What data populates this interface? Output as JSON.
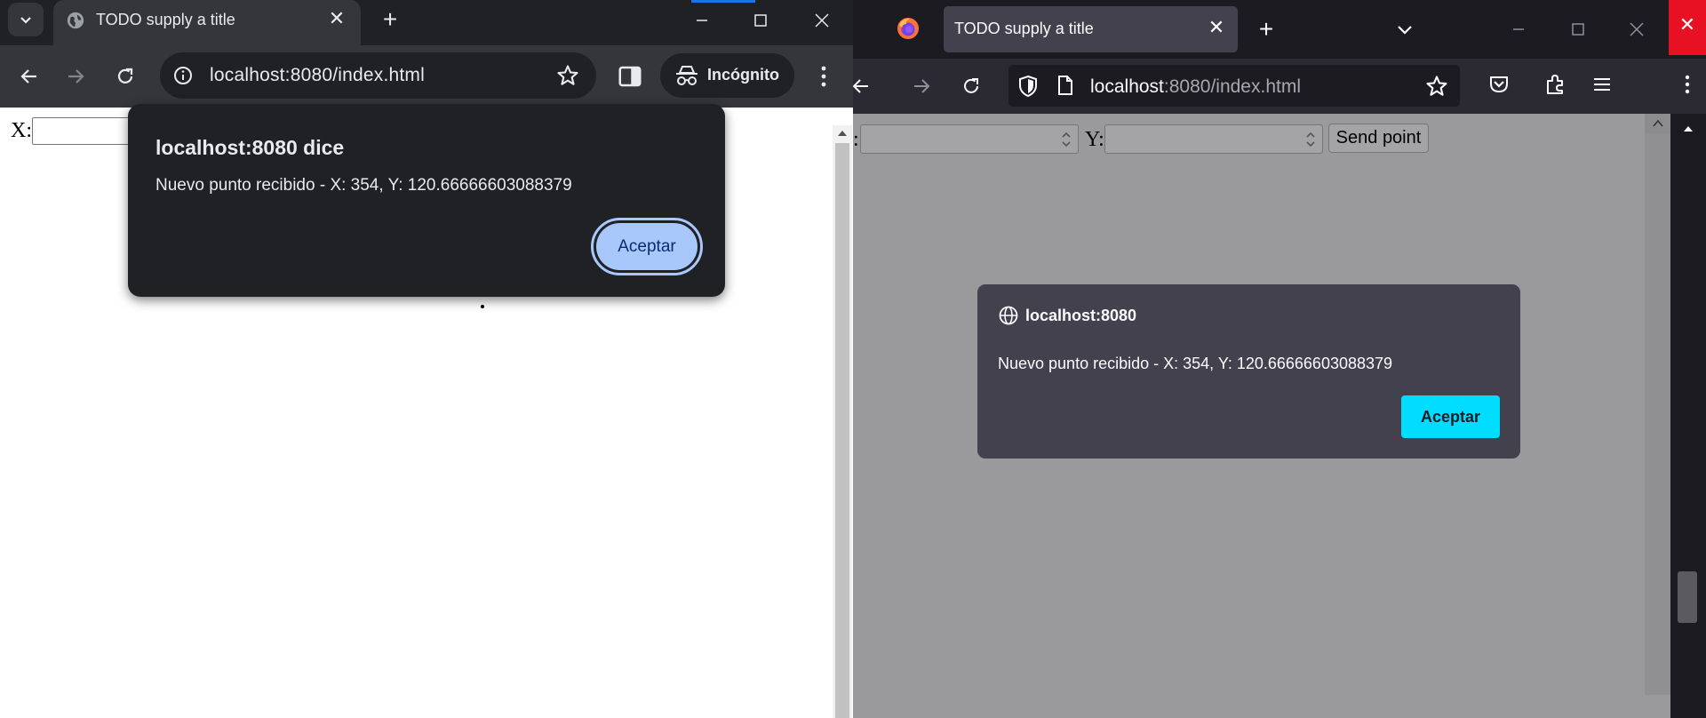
{
  "chrome": {
    "tab_title": "TODO supply a title",
    "new_tab_symbol": "+",
    "close_tab_symbol": "✕",
    "url": "localhost:8080/index.html",
    "incognito_label": "Incógnito",
    "page": {
      "x_label": "X:",
      "x_value": ""
    },
    "dialog": {
      "title": "localhost:8080 dice",
      "message": "Nuevo punto recibido - X: 354, Y: 120.66666603088379",
      "button": "Aceptar"
    },
    "icons": [
      "tab-search-icon",
      "globe-icon",
      "back-icon",
      "forward-icon",
      "reload-icon",
      "site-info-icon",
      "bookmark-star-icon",
      "side-panel-icon",
      "incognito-icon",
      "kebab-menu-icon",
      "minimize-icon",
      "maximize-icon",
      "close-icon"
    ],
    "colors": {
      "dialog_bg": "#202124",
      "button_bg": "#a8c7fa",
      "accent": "#1a73e8"
    }
  },
  "firefox": {
    "tab_title": "TODO supply a title",
    "new_tab_symbol": "+",
    "close_tab_symbol": "✕",
    "url_host": "localhost",
    "url_path": ":8080/index.html",
    "page": {
      "x_label": ":",
      "x_value": "",
      "y_label": "Y:",
      "y_value": "",
      "send_button": "Send point"
    },
    "dialog": {
      "title": "localhost:8080",
      "message": "Nuevo punto recibido - X: 354, Y: 120.66666603088379",
      "button": "Aceptar"
    },
    "icons": [
      "firefox-logo-icon",
      "list-all-tabs-icon",
      "back-icon",
      "forward-icon",
      "reload-icon",
      "shield-icon",
      "page-icon",
      "bookmark-star-icon",
      "pocket-icon",
      "extensions-icon",
      "hamburger-menu-icon",
      "globe-icon",
      "minimize-icon",
      "maximize-icon",
      "close-icon"
    ],
    "colors": {
      "dialog_bg": "#42414d",
      "button_bg": "#00ddff",
      "close_hover": "#e81123"
    }
  }
}
